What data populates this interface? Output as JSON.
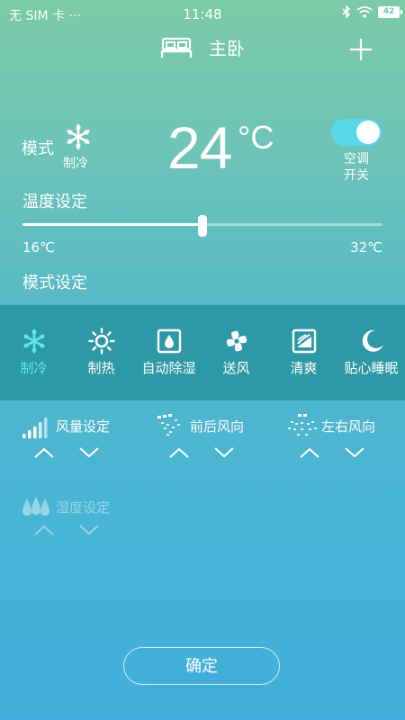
{
  "status_bar": {
    "carrier": "无 SIM 卡 ···",
    "time": "11:48",
    "battery": "42"
  },
  "header": {
    "room": "主卧"
  },
  "current": {
    "mode_label": "模式",
    "mode_value": "制冷",
    "temperature": "24",
    "unit": "°C"
  },
  "power": {
    "label_line1": "空调",
    "label_line2": "开关",
    "on": true
  },
  "temperature_setting": {
    "title": "温度设定",
    "min": "16℃",
    "max": "32℃",
    "value_fraction": 0.5
  },
  "mode_setting": {
    "title": "模式设定",
    "modes": [
      {
        "label": "制冷",
        "icon": "snowflake-icon",
        "active": true
      },
      {
        "label": "制热",
        "icon": "sun-icon",
        "active": false
      },
      {
        "label": "自动除湿",
        "icon": "dehumidify-icon",
        "active": false
      },
      {
        "label": "送风",
        "icon": "fan-icon",
        "active": false
      },
      {
        "label": "清爽",
        "icon": "fresh-icon",
        "active": false
      },
      {
        "label": "贴心睡眠",
        "icon": "moon-icon",
        "active": false
      }
    ]
  },
  "controls": {
    "fan_speed": "风量设定",
    "vertical_swing": "前后风向",
    "horizontal_swing": "左右风向",
    "humidity": "湿度设定"
  },
  "confirm_label": "确定",
  "colors": {
    "active_mode": "#64e6f2",
    "toggle_on": "#58d9ea",
    "panel": "#2d98a6"
  }
}
